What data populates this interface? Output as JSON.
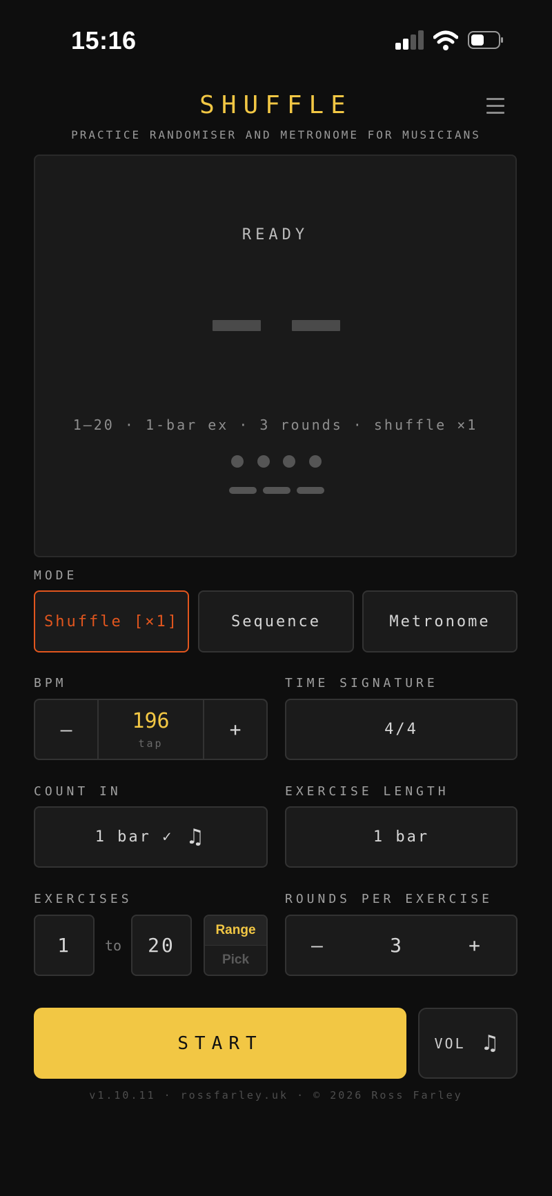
{
  "status_bar": {
    "time": "15:16"
  },
  "header": {
    "title": "SHUFFLE",
    "subtitle": "PRACTICE RANDOMISER AND METRONOME FOR MUSICIANS"
  },
  "display": {
    "state": "READY",
    "summary": "1–20 · 1-bar ex · 3 rounds · shuffle ×1"
  },
  "mode": {
    "label": "MODE",
    "options": [
      "Shuffle [×1]",
      "Sequence",
      "Metronome"
    ],
    "selected": "Shuffle [×1]"
  },
  "bpm": {
    "label": "BPM",
    "minus": "–",
    "value": "196",
    "tap": "tap",
    "plus": "+"
  },
  "time_signature": {
    "label": "TIME SIGNATURE",
    "value": "4/4"
  },
  "count_in": {
    "label": "COUNT IN",
    "value": "1 bar ✓",
    "icon": "music-note-icon",
    "icon_glyph": "♫"
  },
  "exercise_length": {
    "label": "EXERCISE LENGTH",
    "value": "1 bar"
  },
  "exercises": {
    "label": "EXERCISES",
    "from": "1",
    "to_label": "to",
    "to": "20",
    "range_label": "Range",
    "pick_label": "Pick",
    "selected": "Range"
  },
  "rounds": {
    "label": "ROUNDS PER EXERCISE",
    "minus": "–",
    "value": "3",
    "plus": "+"
  },
  "actions": {
    "start": "START",
    "vol": "VOL",
    "vol_icon_glyph": "♫"
  },
  "footer": "v1.10.11 · rossfarley.uk · © 2026 Ross Farley",
  "colors": {
    "accent": "#f2c744",
    "active": "#e2561e",
    "background": "#0e0e0e"
  }
}
